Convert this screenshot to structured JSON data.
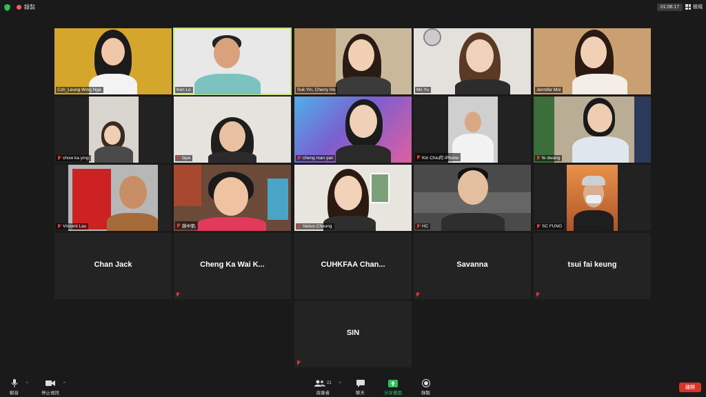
{
  "topbar": {
    "recording_label": "錄製",
    "timer": "01:06:17",
    "view_label": "檢視"
  },
  "tiles": [
    {
      "name": "Cch_Leung Wing Nga"
    },
    {
      "name": "Ken Lo"
    },
    {
      "name": "Suk Yin, Cherry Ho"
    },
    {
      "name": "Ms Yu"
    },
    {
      "name": "Jennifer Moi"
    },
    {
      "name": "chow ka ying"
    },
    {
      "name": "faye"
    },
    {
      "name": "cheng man yan"
    },
    {
      "name": "Kin Chiu的 iPhone"
    },
    {
      "name": "fe dwang"
    },
    {
      "name": "Vincent Lau"
    },
    {
      "name": "趙中凱"
    },
    {
      "name": "Vanus Cheung"
    },
    {
      "name": "HC"
    },
    {
      "name": "SC FUNG"
    },
    {
      "name": "Chan Jack"
    },
    {
      "name": "Cheng Ka Wai K..."
    },
    {
      "name": "CUHKFAA Chan..."
    },
    {
      "name": "Savanna"
    },
    {
      "name": "tsui fai keung"
    },
    {
      "name": "SIN"
    }
  ],
  "toolbar": {
    "unmute_label": "解音",
    "video_label": "停止視訊",
    "participants_label": "與會者",
    "participants_count": "21",
    "chat_label": "聊天",
    "share_label": "分享畫面",
    "record_label": "錄製",
    "end_label": "離開"
  },
  "colors": {
    "accent_green": "#2fbf5b",
    "active_speaker": "#c7e37a",
    "end_red": "#d9342b",
    "muted_red": "#e03a3a"
  }
}
